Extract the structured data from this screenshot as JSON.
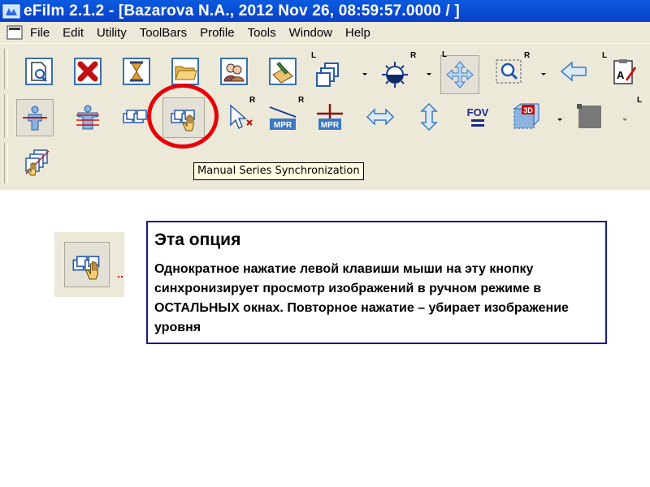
{
  "window": {
    "title": "eFilm 2.1.2 - [Bazarova N.A., 2012 Nov 26, 08:59:57.0000  /  ]"
  },
  "menu": {
    "items": [
      "File",
      "Edit",
      "Utility",
      "ToolBars",
      "Profile",
      "Tools",
      "Window",
      "Help"
    ]
  },
  "toolbar": {
    "tags": {
      "l": "L",
      "r": "R"
    },
    "mpr_label": "MPR",
    "fov_label": "FOV",
    "threed_label": "3D",
    "tooltip": "Manual Series Synchronization"
  },
  "callout": {
    "heading": "Эта опция",
    "body": "Однократное нажатие левой клавиши мыши на эту кнопку  синхронизирует просмотр изображений в ручном режиме в ОСТАЛЬНЫХ окнах. Повторное нажатие – убирает изображение уровня"
  },
  "colors": {
    "titlebar": "#0a4fd8",
    "toolbar_bg": "#ece9d8",
    "highlight_circle": "#e8000b",
    "callout_border": "#1a1a8c",
    "tooltip_bg": "#ffffe1"
  }
}
